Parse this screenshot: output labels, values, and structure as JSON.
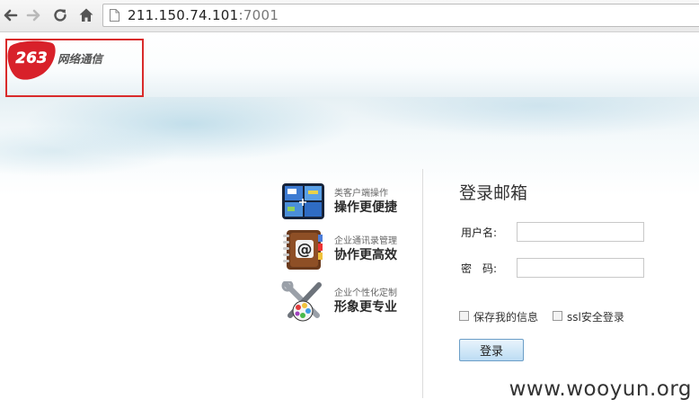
{
  "browser": {
    "address": {
      "host": "211.150.74.101",
      "port": ":7001"
    },
    "icons": {
      "back": "back-arrow-icon",
      "forward": "forward-arrow-icon",
      "reload": "reload-icon",
      "home": "home-icon",
      "page": "page-icon"
    }
  },
  "logo": {
    "number": "263",
    "text": "网络通信"
  },
  "features": [
    {
      "sub": "类客户端操作",
      "main": "操作更便捷",
      "icon": "window-panes-icon"
    },
    {
      "sub": "企业通讯录管理",
      "main": "协作更高效",
      "icon": "address-book-icon"
    },
    {
      "sub": "企业个性化定制",
      "main": "形象更专业",
      "icon": "tools-palette-icon"
    }
  ],
  "login": {
    "title": "登录邮箱",
    "username_label": "用户名:",
    "password_label": "密　码:",
    "username_value": "",
    "password_value": "",
    "remember_label": "保存我的信息",
    "ssl_label": "ssl安全登录",
    "submit_label": "登录"
  },
  "watermark": "www.wooyun.org",
  "colors": {
    "logo_red": "#d8212a",
    "highlight_border": "#d92b2b",
    "button_border": "#6b9ec7"
  }
}
